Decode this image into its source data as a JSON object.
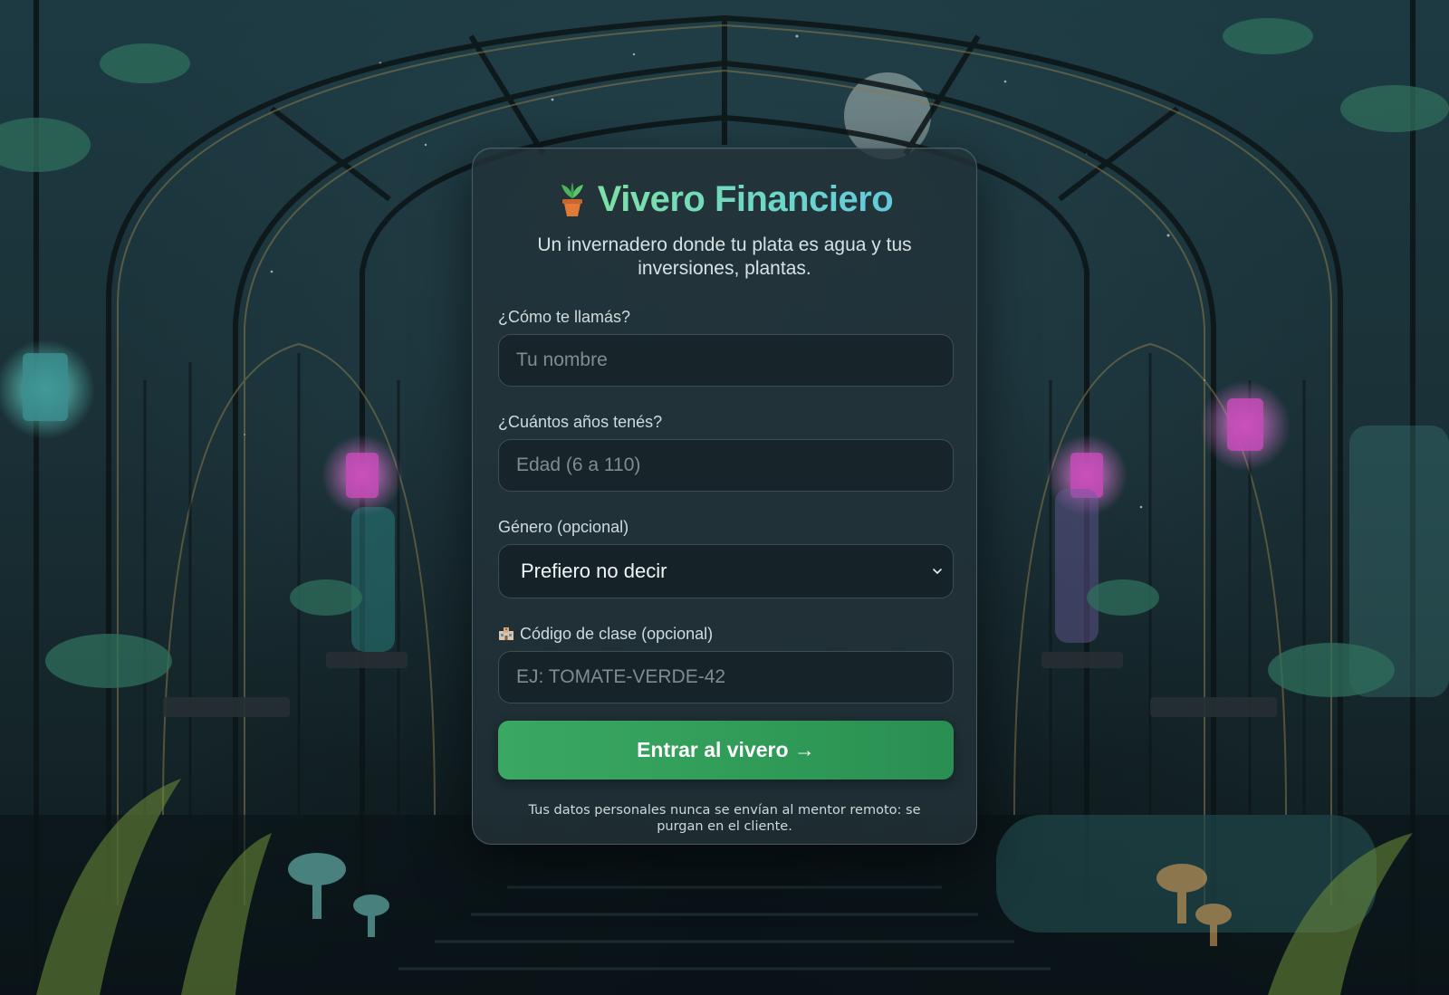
{
  "app": {
    "title": "Vivero Financiero",
    "title_icon": "potted-plant-icon",
    "subtitle": "Un invernadero donde tu plata es agua y tus inversiones, plantas."
  },
  "form": {
    "name_label": "¿Cómo te llamás?",
    "name_placeholder": "Tu nombre",
    "name_value": "",
    "age_label": "¿Cuántos años tenés?",
    "age_placeholder": "Edad (6 a 110)",
    "age_value": "",
    "gender_label": "Género (opcional)",
    "gender_selected": "Prefiero no decir",
    "class_code_label": "Código de clase (opcional)",
    "class_code_icon": "school-icon",
    "class_code_placeholder": "EJ: TOMATE-VERDE-42",
    "class_code_value": "",
    "submit_label": "Entrar al vivero →",
    "privacy_note": "Tus datos personales nunca se envían al mentor remoto: se purgan en el cliente."
  },
  "colors": {
    "accent_green": "#2f9b57",
    "title_gradient_start": "#7ee0a4",
    "title_gradient_end": "#63c9dc",
    "card_bg": "#223238"
  }
}
